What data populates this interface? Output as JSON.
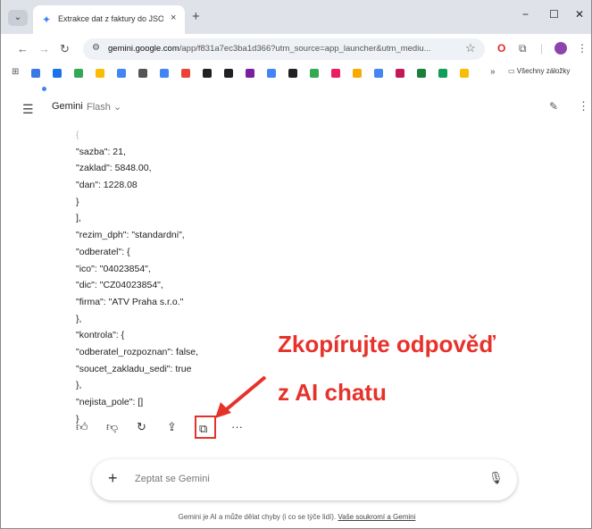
{
  "tab": {
    "title": "Extrakce dat z faktury do JSON",
    "close": "×",
    "new_tab": "+"
  },
  "window": {
    "minimize": "−",
    "maximize": "☐",
    "close": "✕"
  },
  "toolbar": {
    "url_host": "gemini.google.com",
    "url_rest": "/app/f831a7ec3ba1d366?utm_source=app_launcher&utm_mediu..."
  },
  "bookmarks": {
    "more": "»",
    "folder_label": "Všechny záložky",
    "colors": [
      "#3b78e7",
      "#1a73e8",
      "#34a853",
      "#fbbc04",
      "#4285f4",
      "#555555",
      "#4285f4",
      "#ea4335",
      "#202124",
      "#202124",
      "#7b1fa2",
      "#4285f4",
      "#202124",
      "#34a853",
      "#e91e63",
      "#f9ab00",
      "#4285f4",
      "#c2185b",
      "#188038",
      "#0f9d58",
      "#fbbc04"
    ]
  },
  "app": {
    "name": "Gemini",
    "model": "Flash",
    "model_caret": "⌄"
  },
  "code_lines": [
    "{",
    "\"sazba\": 21,",
    "\"zaklad\": 5848.00,",
    "\"dan\": 1228.08",
    "}",
    "],",
    "\"rezim_dph\": \"standardni\",",
    "\"odberatel\": {",
    "\"ico\": \"04023854\",",
    "\"dic\": \"CZ04023854\",",
    "\"firma\": \"ATV Praha s.r.o.\"",
    "},",
    "\"kontrola\": {",
    "\"odberatel_rozpoznan\": false,",
    "\"soucet_zakladu_sedi\": true",
    "},",
    "\"nejista_pole\": []",
    "}"
  ],
  "annotation": {
    "line1": "Zkopírujte odpověď",
    "line2": "z AI chatu",
    "color": "#e6322b"
  },
  "input": {
    "placeholder": "Zeptat se Gemini",
    "plus": "+"
  },
  "disclaimer": {
    "text": "Gemini je AI a může dělat chyby (i co se týče lidí). ",
    "link": "Vaše soukromí a Gemini"
  },
  "icons": {
    "more_actions": "···"
  }
}
